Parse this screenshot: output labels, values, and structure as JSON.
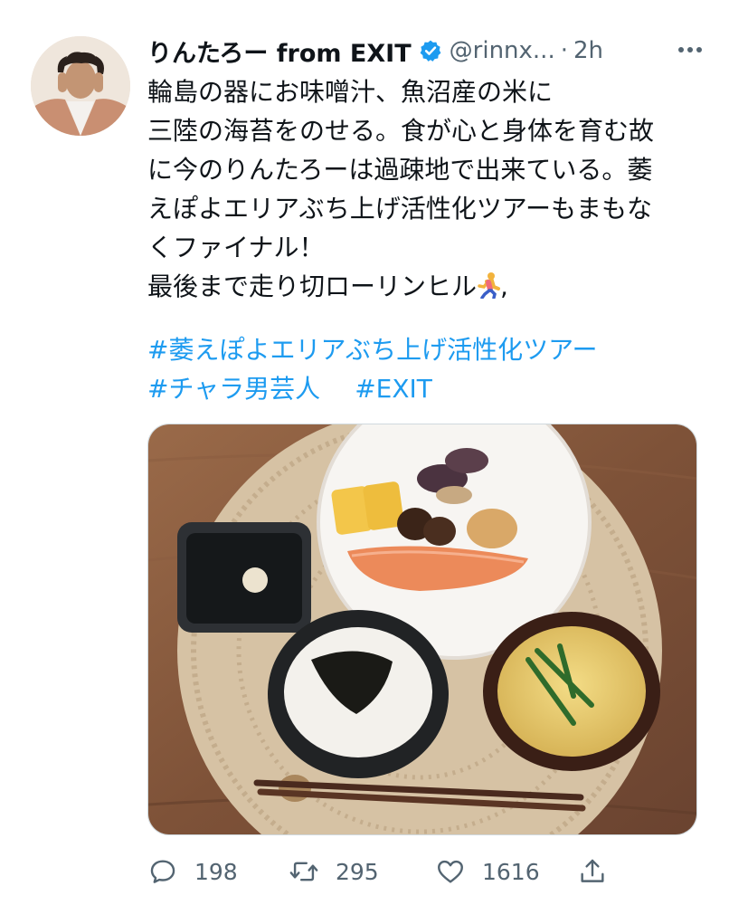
{
  "author": {
    "display_name": "りんたろー from EXIT",
    "handle": "@rinnx...",
    "separator": "·",
    "time": "2h",
    "verified": true
  },
  "tweet": {
    "lines": [
      "輪島の器にお味噌汁、魚沼産の米に",
      "三陸の海苔をのせる。食が心と身体を育む故",
      "に今のりんたろーは過疎地で出来ている。萎",
      "えぽよエリアぶち上げ活性化ツアーもまもな",
      "くファイナル！",
      "最後まで走り切ローリンヒル"
    ],
    "line6_suffix": ",",
    "hashtags": [
      "#萎えぽよエリアぶち上げ活性化ツアー",
      "#チャラ男芸人",
      "#EXIT"
    ]
  },
  "actions": {
    "reply_count": "198",
    "retweet_count": "295",
    "like_count": "1616"
  },
  "colors": {
    "link": "#1d9bf0",
    "secondary_text": "#536471",
    "verified_badge": "#1d9bf0"
  },
  "icons": {
    "reply": "speech-bubble-icon",
    "retweet": "retweet-arrows-icon",
    "like": "heart-icon",
    "share": "share-upload-icon",
    "more": "more-dots-icon",
    "verified": "verified-badge-icon",
    "emoji": "runner-emoji-icon"
  }
}
